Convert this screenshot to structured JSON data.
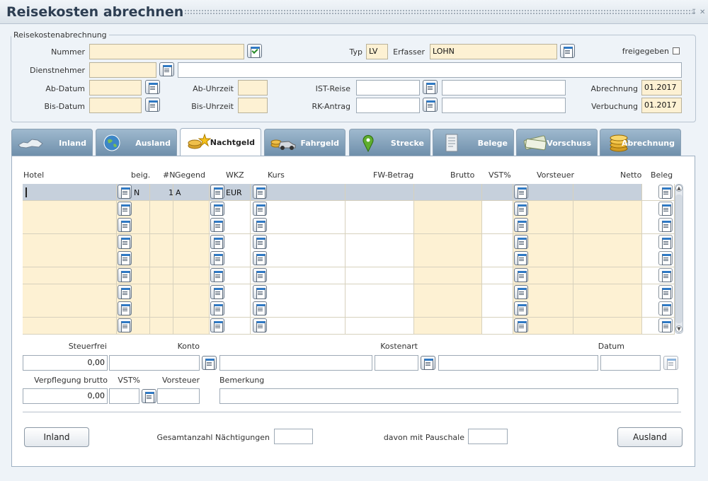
{
  "window": {
    "title": "Reisekosten abrechnen"
  },
  "header": {
    "group_title": "Reisekostenabrechnung",
    "nummer_label": "Nummer",
    "nummer_value": "",
    "typ_label": "Typ",
    "typ_value": "LV",
    "erfasser_label": "Erfasser",
    "erfasser_value": "LOHN",
    "freigegeben_label": "freigegeben",
    "dienstnehmer_label": "Dienstnehmer",
    "ab_datum_label": "Ab-Datum",
    "ab_uhrzeit_label": "Ab-Uhrzeit",
    "bis_datum_label": "Bis-Datum",
    "bis_uhrzeit_label": "Bis-Uhrzeit",
    "ist_reise_label": "IST-Reise",
    "rk_antrag_label": "RK-Antrag",
    "abrechnung_label": "Abrechnung",
    "abrechnung_value": "01.2017",
    "verbuchung_label": "Verbuchung",
    "verbuchung_value": "01.2017"
  },
  "tabs": [
    {
      "label": "Inland",
      "icon": "austria-map-icon"
    },
    {
      "label": "Ausland",
      "icon": "globe-icon"
    },
    {
      "label": "Nachtgeld",
      "icon": "coins-stars-icon"
    },
    {
      "label": "Fahrgeld",
      "icon": "car-coins-icon"
    },
    {
      "label": "Strecke",
      "icon": "map-pin-icon"
    },
    {
      "label": "Belege",
      "icon": "receipt-icon"
    },
    {
      "label": "Vorschuss",
      "icon": "cash-icon"
    },
    {
      "label": "Abrechnung",
      "icon": "coin-stack-icon"
    }
  ],
  "active_tab": "Nachtgeld",
  "grid": {
    "columns": [
      "Hotel",
      "beig.",
      "#N",
      "Gegend",
      "WKZ",
      "Kurs",
      "FW-Betrag",
      "Brutto",
      "VST%",
      "Vorsteuer",
      "Netto",
      "Beleg"
    ],
    "first_row": {
      "beig": "N",
      "n": "1",
      "gegend": "A",
      "wkz": "EUR"
    }
  },
  "footer": {
    "steuerfrei_label": "Steuerfrei",
    "steuerfrei_value": "0,00",
    "konto_label": "Konto",
    "kostenart_label": "Kostenart",
    "datum_label": "Datum",
    "verpflegung_label": "Verpflegung brutto",
    "verpflegung_value": "0,00",
    "vst_label": "VST%",
    "vorsteuer_label": "Vorsteuer",
    "bemerkung_label": "Bemerkung",
    "inland_button": "Inland",
    "ausland_button": "Ausland",
    "gesamt_label": "Gesamtanzahl Nächtigungen",
    "pauschale_label": "davon mit Pauschale"
  },
  "colors": {
    "title": "#2d3e52",
    "required_field": "#fdf1d3",
    "tab_inactive": "#7f9db6",
    "selected_row": "#c6d0dc"
  }
}
